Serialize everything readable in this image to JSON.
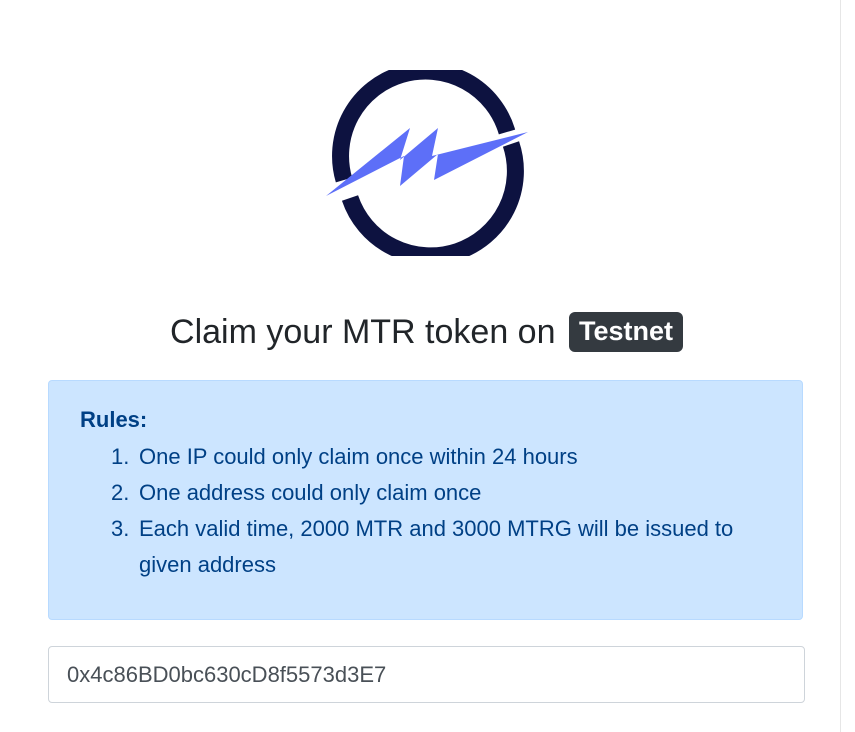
{
  "logo": {
    "icon": "meter-lightning-logo-icon"
  },
  "heading": {
    "text": "Claim your MTR token on",
    "network_badge": "Testnet"
  },
  "rules": {
    "title": "Rules:",
    "items": [
      {
        "num": "1.",
        "text": "One IP could only claim once within 24 hours"
      },
      {
        "num": "2.",
        "text": "One address could only claim once"
      },
      {
        "num": "3.",
        "text": "Each valid time, 2000 MTR and 3000 MTRG will be issued to given address"
      }
    ]
  },
  "address_input": {
    "value": "0x4c86BD0bc630cD8f5573d3E7"
  },
  "colors": {
    "logo_ring": "#0d1240",
    "logo_bolt": "#5d6ff8",
    "rules_bg": "#cce5ff",
    "rules_text": "#004085",
    "badge_bg": "#343a40"
  }
}
